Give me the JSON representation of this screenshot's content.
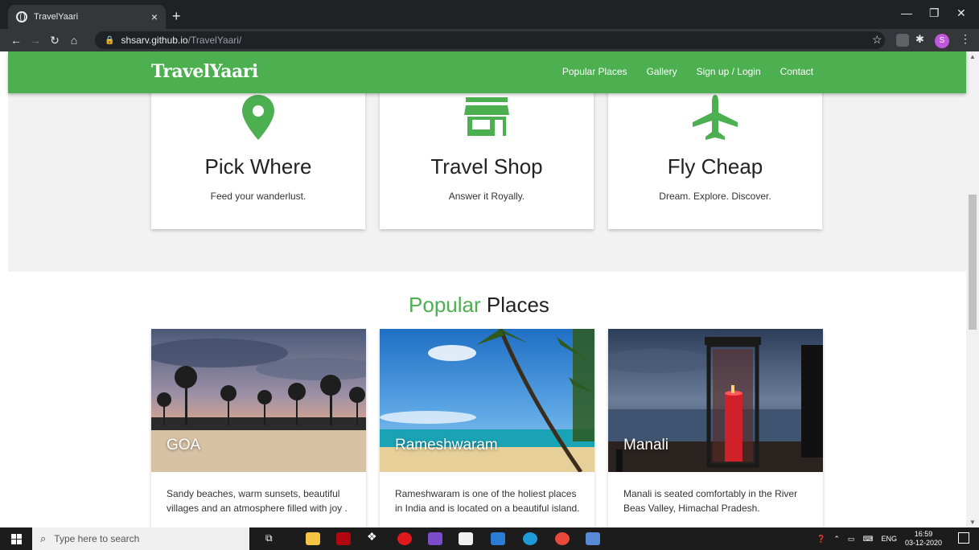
{
  "browser": {
    "tab_title": "TravelYaari",
    "tab_close": "×",
    "new_tab": "+",
    "url_host": "shsarv.github.io",
    "url_path": "/TravelYaari/",
    "profile_initial": "S"
  },
  "navbar": {
    "brand": "TravelYaari",
    "links": [
      "Popular Places",
      "Gallery",
      "Sign up / Login",
      "Contact"
    ]
  },
  "features": [
    {
      "icon": "map-pin-icon",
      "title": "Pick Where",
      "subtitle": "Feed your wanderlust."
    },
    {
      "icon": "shop-icon",
      "title": "Travel Shop",
      "subtitle": "Answer it Royally."
    },
    {
      "icon": "airplane-icon",
      "title": "Fly Cheap",
      "subtitle": "Dream. Explore. Discover."
    }
  ],
  "popular": {
    "title_accent": "Popular",
    "title_rest": " Places",
    "places": [
      {
        "name": "GOA",
        "description": "Sandy beaches, warm sunsets, beautiful villages and an atmosphere filled with joy ."
      },
      {
        "name": "Rameshwaram",
        "description": "Rameshwaram is one of the holiest places in India and is located on a beautiful island."
      },
      {
        "name": "Manali",
        "description": "Manali is seated comfortably in the River Beas Valley, Himachal Pradesh."
      }
    ]
  },
  "taskbar": {
    "search_placeholder": "Type here to search",
    "language": "ENG",
    "time": "16:59",
    "date": "03-12-2020"
  },
  "colors": {
    "brand_green": "#4caf50",
    "chrome_dark": "#202124"
  }
}
